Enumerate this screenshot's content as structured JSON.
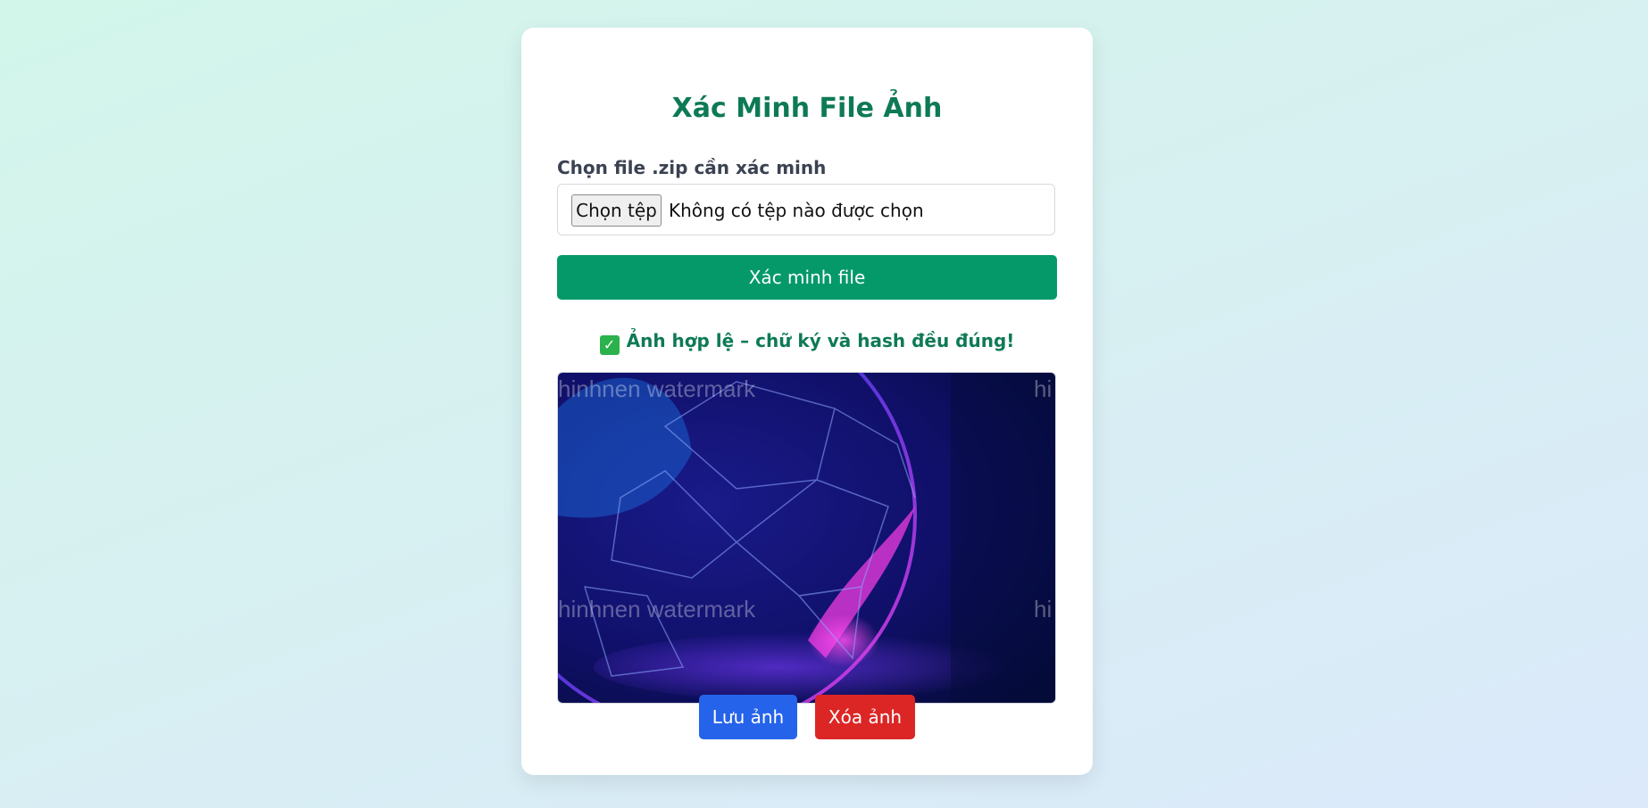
{
  "card": {
    "title": "Xác Minh File Ảnh",
    "file_label": "Chọn file .zip cần xác minh",
    "file_input": {
      "button_label": "Chọn tệp",
      "status_text": "Không có tệp nào được chọn"
    },
    "verify_button": "Xác minh file",
    "status": {
      "icon": "check-icon",
      "text": "Ảnh hợp lệ – chữ ký và hash đều đúng!"
    },
    "preview": {
      "watermark_text": "hinhnen watermark",
      "watermark_text_partial": "hi"
    },
    "actions": {
      "save_label": "Lưu ảnh",
      "delete_label": "Xóa ảnh"
    }
  },
  "colors": {
    "title": "#0e7a55",
    "verify": "#05996a",
    "save": "#2563eb",
    "delete": "#dc2626"
  }
}
